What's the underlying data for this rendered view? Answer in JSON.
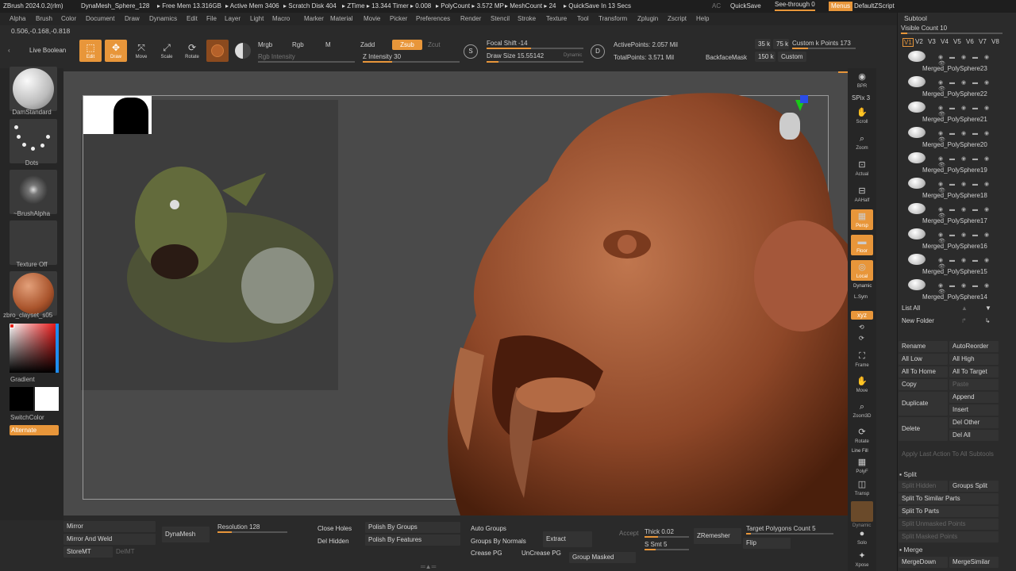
{
  "titlebar": {
    "app": "ZBrush 2024.0.2(rlm)",
    "doc": "DynaMesh_Sphere_128",
    "free_mem": "▸ Free Mem 13.316GB",
    "active_mem": "▸ Active Mem 3406",
    "scratch": "▸ Scratch Disk 404",
    "ztime": "▸ ZTime ▸ 13.344 Timer ▸ 0.008",
    "polycount": "▸ PolyCount ▸ 3.572 MP",
    "meshcount": "▸ MeshCount ▸ 24",
    "quicksave_in": "▸ QuickSave In 13 Secs",
    "ac": "AC",
    "quicksave": "QuickSave",
    "see_through": "See-through  0",
    "menus": "Menus",
    "defaultzscript": "DefaultZScript"
  },
  "menu": [
    "Alpha",
    "Brush",
    "Color",
    "Document",
    "Draw",
    "Dynamics",
    "Edit",
    "File",
    "Layer",
    "Light",
    "Macro",
    "Marker",
    "Material",
    "Movie",
    "Picker",
    "Preferences",
    "Render",
    "Stencil",
    "Stroke",
    "Texture",
    "Tool",
    "Transform",
    "Zplugin",
    "Zscript",
    "Help"
  ],
  "coords": "0.506,-0.168,-0.818",
  "toolbar": {
    "live_boolean": "Live Boolean",
    "edit": "Edit",
    "draw": "Draw",
    "move": "Move",
    "scale": "Scale",
    "rotate": "Rotate",
    "mrgb": "Mrgb",
    "rgb": "Rgb",
    "m": "M",
    "rgb_intensity": "Rgb Intensity",
    "zadd": "Zadd",
    "zsub": "Zsub",
    "zcut": "Zcut",
    "z_intensity": "Z Intensity 30",
    "z_intensity_value": 0.3,
    "focal_shift": "Focal Shift -14",
    "draw_size": "Draw Size 15.55142",
    "dynamic": "Dynamic",
    "active_points": "ActivePoints: 2.057 Mil",
    "total_points": "TotalPoints: 3.571 Mil",
    "backface": "BackfaceMask",
    "k35": "35 k",
    "k75": "75 k",
    "k150": "150 k",
    "custom_k": "Custom k Points 173",
    "custom": "Custom"
  },
  "leftshelf": {
    "brush": "DamStandard",
    "stroke": "Dots",
    "alpha": "~BrushAlpha",
    "texture": "Texture Off",
    "material": "zbro_clayset_s05",
    "gradient": "Gradient",
    "switchcolor": "SwitchColor",
    "alternate": "Alternate"
  },
  "rightshelf": [
    "BPR",
    "SPix 3",
    "Scroll",
    "Zoom",
    "Actual",
    "AAHalf",
    "Persp",
    "Floor",
    "Local",
    "Dynamic",
    "L.Sym",
    "xyz",
    "Frame",
    "Move",
    "Zoom3D",
    "Rotate",
    "Line Fill",
    "PolyF",
    "Transp",
    "Dynamic",
    "Solo",
    "Xpose"
  ],
  "subtool": {
    "header": "Subtool",
    "visible_count": "Visible Count 10",
    "versions": [
      "V1",
      "V2",
      "V3",
      "V4",
      "V5",
      "V6",
      "V7",
      "V8"
    ],
    "items": [
      "Merged_PolySphere23",
      "Merged_PolySphere22",
      "Merged_PolySphere21",
      "Merged_PolySphere20",
      "Merged_PolySphere19",
      "Merged_PolySphere18",
      "Merged_PolySphere17",
      "Merged_PolySphere16",
      "Merged_PolySphere15",
      "Merged_PolySphere14"
    ],
    "list_all": "List All",
    "new_folder": "New Folder",
    "rename": "Rename",
    "autoreorder": "AutoReorder",
    "all_low": "All Low",
    "all_high": "All High",
    "all_to_home": "All To Home",
    "all_to_target": "All To Target",
    "copy": "Copy",
    "paste": "Paste",
    "append": "Append",
    "duplicate": "Duplicate",
    "insert": "Insert",
    "del_other": "Del Other",
    "delete": "Delete",
    "del_all": "Del All",
    "apply_last": "Apply Last Action To All Subtools",
    "split": "Split",
    "split_hidden": "Split Hidden",
    "groups_split": "Groups Split",
    "split_similar": "Split To Similar Parts",
    "split_parts": "Split To Parts",
    "split_unmasked": "Split Unmasked Points",
    "split_masked": "Split Masked Points",
    "merge": "Merge",
    "mergedown": "MergeDown",
    "mergesimilar": "MergeSimilar"
  },
  "bottom": {
    "mirror": "Mirror",
    "mirror_weld": "Mirror And Weld",
    "storemt": "StoreMT",
    "delmt": "DelMT",
    "dynamesh": "DynaMesh",
    "resolution": "Resolution 128",
    "close_holes": "Close Holes",
    "del_hidden": "Del Hidden",
    "polish_groups": "Polish By Groups",
    "polish_features": "Polish By Features",
    "auto_groups": "Auto Groups",
    "groups_normals": "Groups By Normals",
    "crease_pg": "Crease PG",
    "uncrease_pg": "UnCrease PG",
    "extract": "Extract",
    "group_masked": "Group Masked",
    "accept": "Accept",
    "thick": "Thick 0.02",
    "s_smt": "S Smt 5",
    "zremesher": "ZRemesher",
    "target_poly": "Target Polygons Count 5",
    "flip": "Flip"
  }
}
